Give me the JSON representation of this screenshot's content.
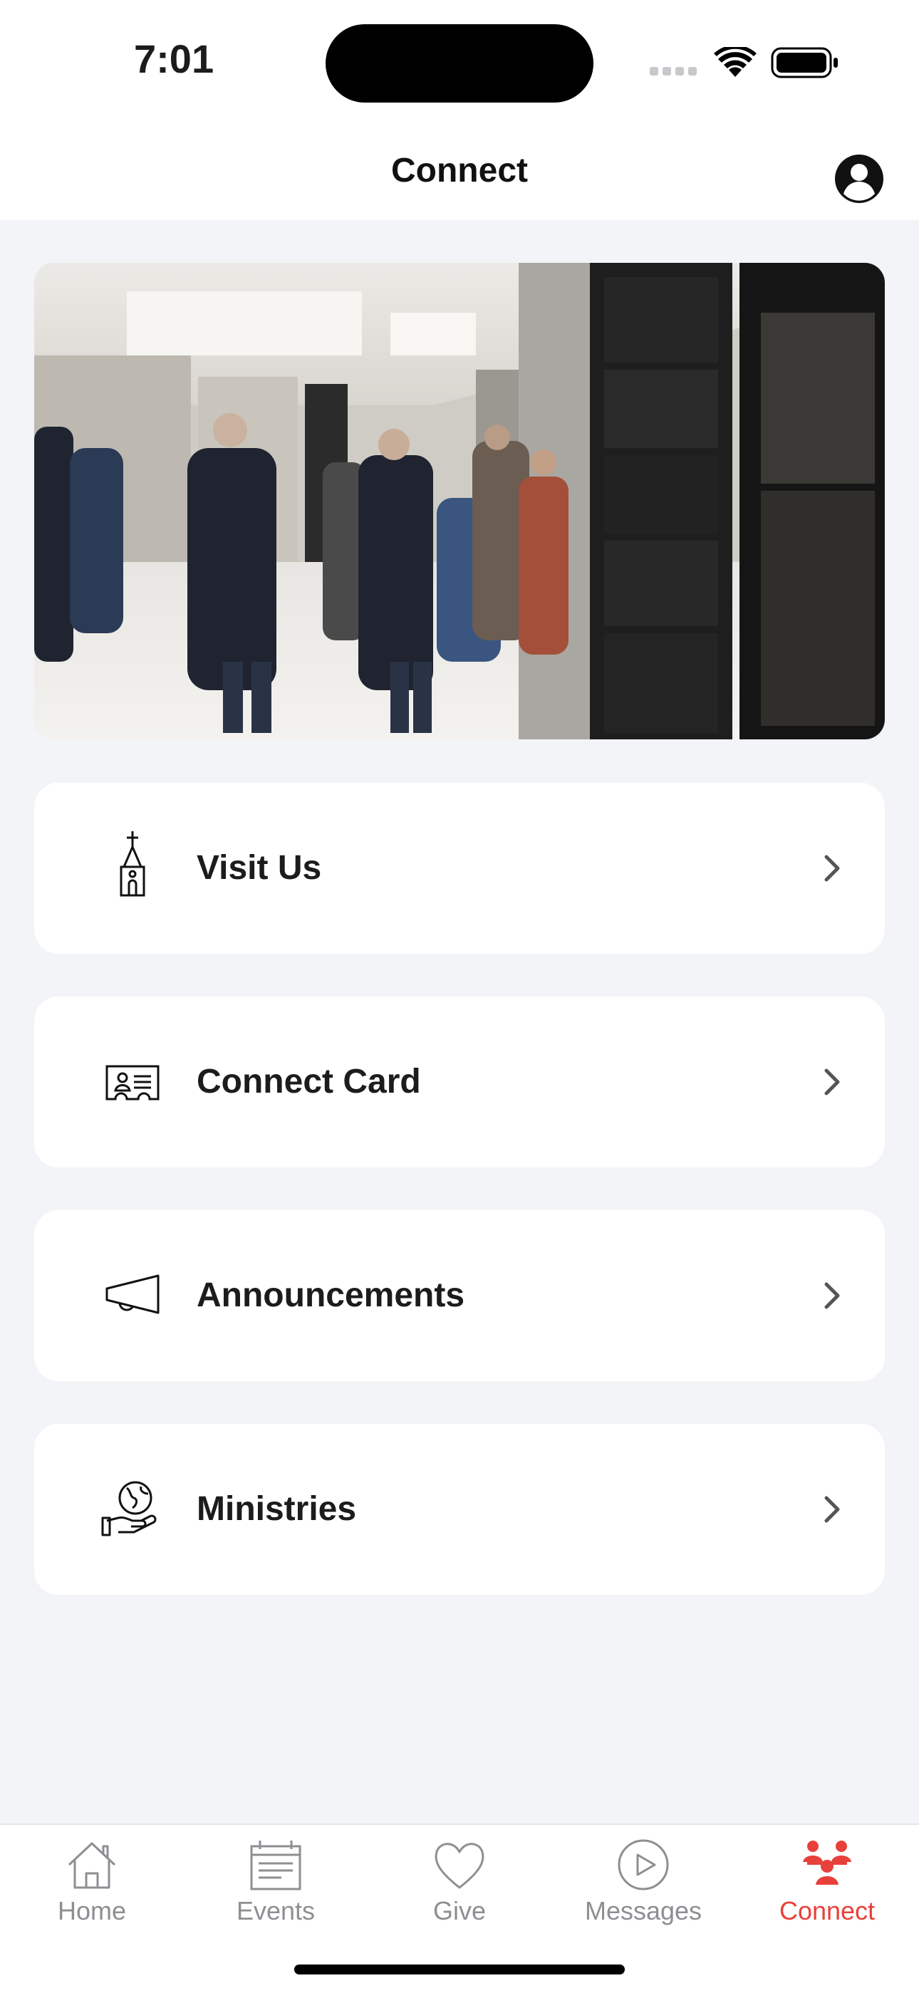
{
  "status_bar": {
    "time": "7:01"
  },
  "header": {
    "title": "Connect"
  },
  "hero": {
    "alt": "People gathering in a hallway"
  },
  "menu": [
    {
      "label": "Visit Us",
      "icon": "church-icon"
    },
    {
      "label": "Connect Card",
      "icon": "id-card-icon"
    },
    {
      "label": "Announcements",
      "icon": "megaphone-icon"
    },
    {
      "label": "Ministries",
      "icon": "globe-hand-icon"
    }
  ],
  "tabs": [
    {
      "label": "Home",
      "icon": "house-icon"
    },
    {
      "label": "Events",
      "icon": "calendar-icon"
    },
    {
      "label": "Give",
      "icon": "heart-icon"
    },
    {
      "label": "Messages",
      "icon": "play-circle-icon"
    },
    {
      "label": "Connect",
      "icon": "people-icon",
      "active": true
    }
  ],
  "colors": {
    "accent": "#e8403a",
    "inactive": "#8e8e93",
    "background": "#f2f4f7"
  }
}
